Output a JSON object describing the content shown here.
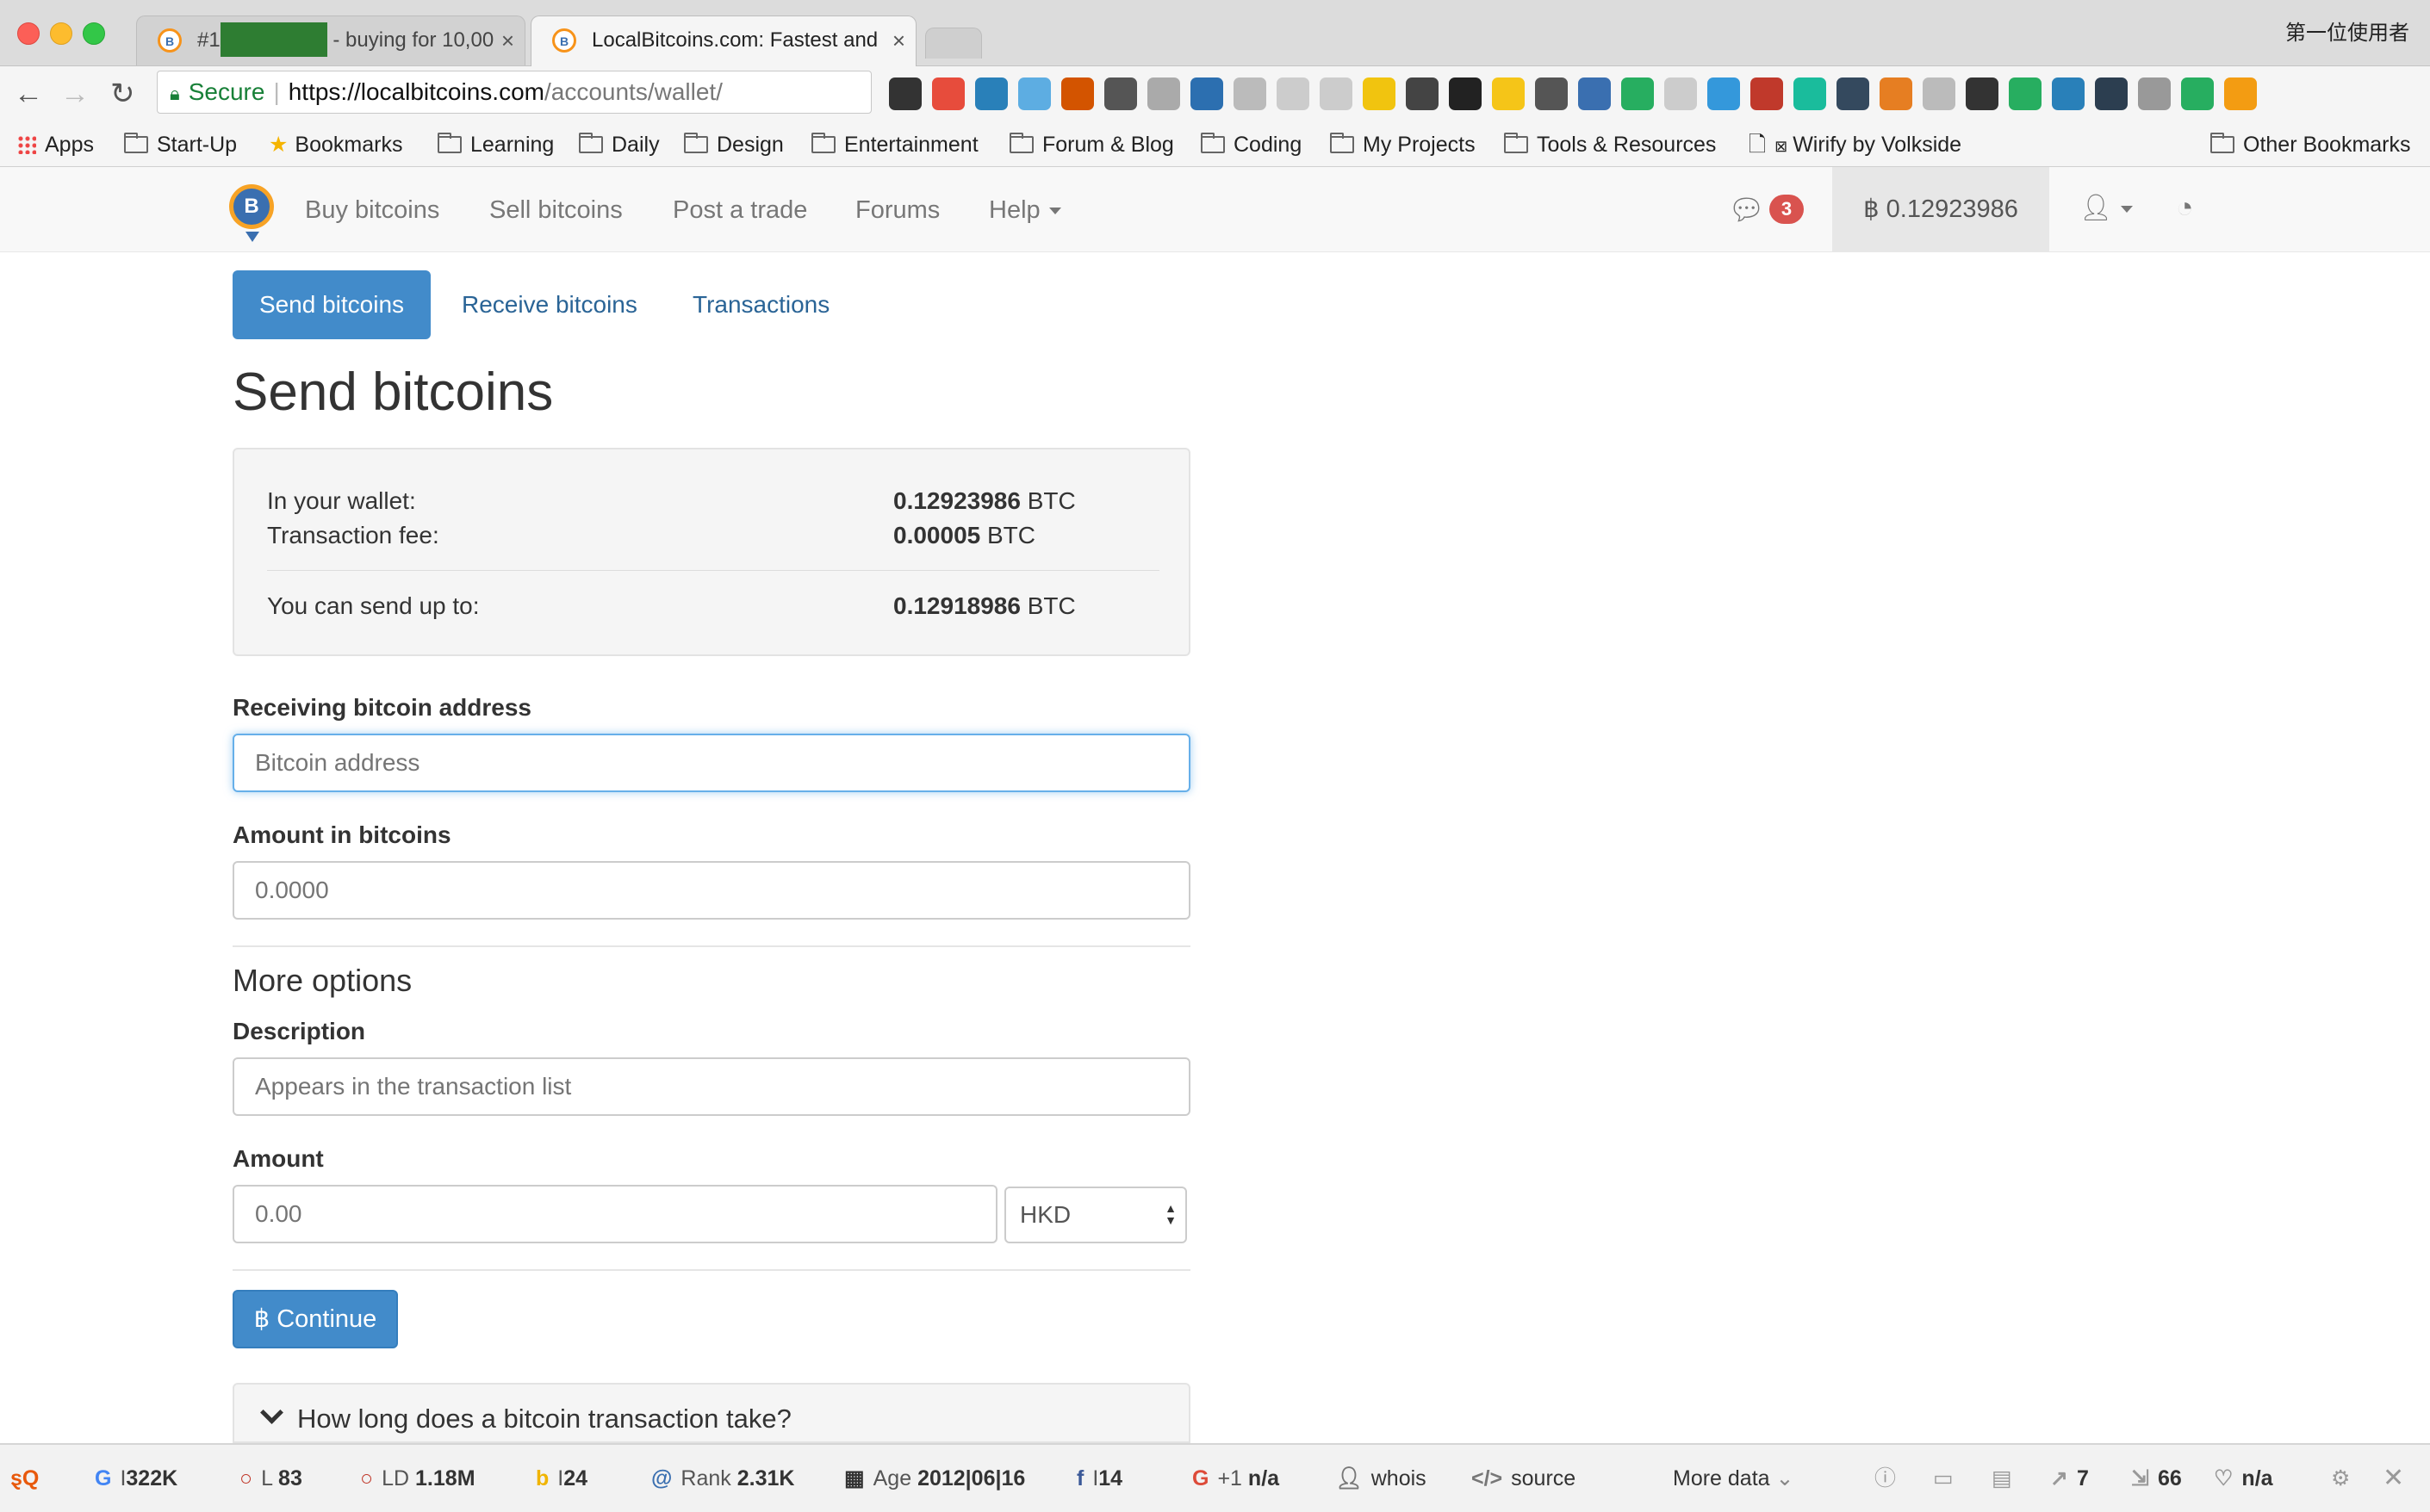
{
  "browser": {
    "tabs": [
      {
        "label_prefix": "#1",
        "label_suffix": "- buying for 10,00",
        "close": "×"
      },
      {
        "label": "LocalBitcoins.com: Fastest and",
        "close": "×"
      }
    ],
    "profile_name": "第一位使用者",
    "address": {
      "secure": "Secure",
      "scheme": "https://",
      "host": "localbitcoins.com",
      "path": "/accounts/wallet/"
    },
    "extensions": [
      "layers",
      "pocket",
      "vimeo",
      "FTL",
      "note",
      "star",
      "puzzle",
      "compass",
      "cloud",
      "Gif",
      "copy",
      "smiley",
      "film",
      "hexagon",
      "chat",
      "bulb",
      "501",
      "D",
      "circle",
      "eye",
      "reader",
      "g",
      "K",
      "SEO",
      "tool",
      "mask",
      "frog",
      "chat2",
      "pen",
      "ext",
      "check",
      "!"
    ],
    "bookmarks": [
      "Apps",
      "Start-Up",
      "Bookmarks",
      "Learning",
      "Daily",
      "Design",
      "Entertainment",
      "Forum & Blog",
      "Coding",
      "My Projects",
      "Tools & Resources",
      "Wirify by Volkside",
      "Other Bookmarks"
    ]
  },
  "sitenav": {
    "items": [
      "Buy bitcoins",
      "Sell bitcoins",
      "Post a trade",
      "Forums",
      "Help"
    ],
    "message_count": "3",
    "balance": "0.12923986",
    "btc_symbol": "฿"
  },
  "subnav": {
    "tabs": [
      "Send bitcoins",
      "Receive bitcoins",
      "Transactions"
    ]
  },
  "page": {
    "title": "Send bitcoins",
    "wallet": {
      "in_wallet_label": "In your wallet:",
      "in_wallet_value": "0.12923986",
      "unit": "BTC",
      "fee_label": "Transaction fee:",
      "fee_value": "0.00005",
      "send_up_to_label": "You can send up to:",
      "send_up_to_value": "0.12918986"
    },
    "form": {
      "address_label": "Receiving bitcoin address",
      "address_placeholder": "Bitcoin address",
      "amount_btc_label": "Amount in bitcoins",
      "amount_btc_placeholder": "0.0000",
      "more_options": "More options",
      "description_label": "Description",
      "description_placeholder": "Appears in the transaction list",
      "amount_label": "Amount",
      "amount_placeholder": "0.00",
      "currency": "HKD",
      "continue": "Continue"
    },
    "faq_question": "How long does a bitcoin transaction take?"
  },
  "seobar": {
    "google_index": "322K",
    "links": "83",
    "links_label": "L",
    "linking_domains": "1.18M",
    "ld_label": "LD",
    "bing_index": "24",
    "rank_label": "Rank",
    "rank": "2.31K",
    "age_label": "Age",
    "age": "2012|06|16",
    "facebook": "14",
    "gplus_label": "+1",
    "gplus": "n/a",
    "whois": "whois",
    "source": "source",
    "more_data": "More data",
    "external_links": "7",
    "internal_links": "66",
    "health": "n/a"
  },
  "colors": {
    "primary": "#428bca",
    "badge": "#d9534f",
    "secure": "#188038",
    "bitcoin_orange": "#f7931a"
  }
}
